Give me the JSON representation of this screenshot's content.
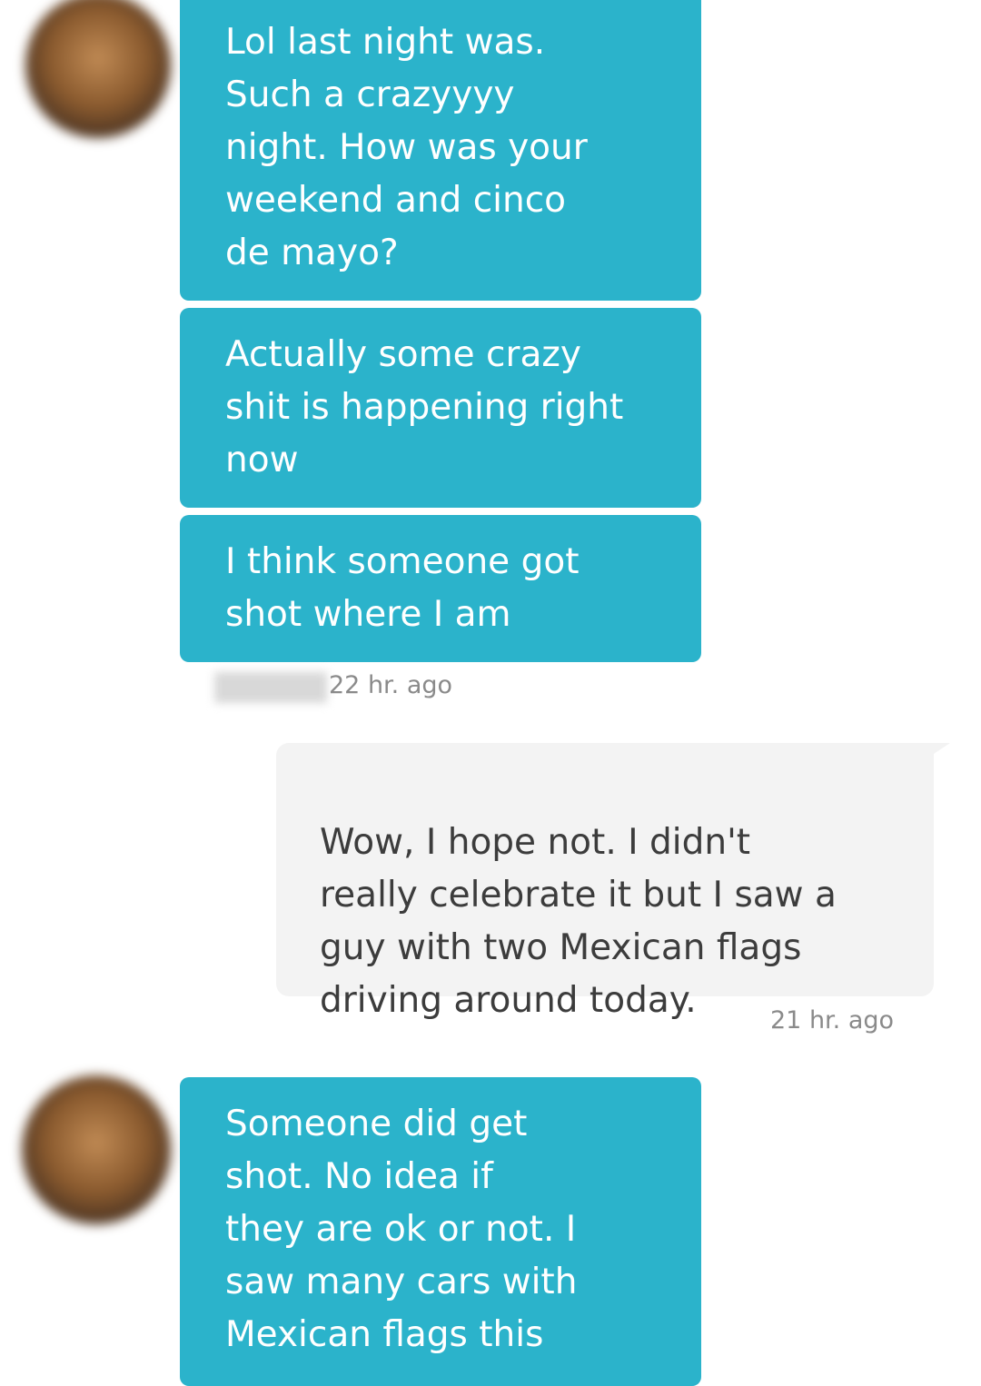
{
  "conversation": {
    "messages": [
      {
        "sender": "them",
        "text": "Lol last night was.\nSuch a crazyyyy\nnight. How was your\nweekend and cinco\nde mayo?"
      },
      {
        "sender": "them",
        "text": "Actually some crazy\nshit is happening right\nnow"
      },
      {
        "sender": "them",
        "text": "I think someone got\nshot where I am"
      },
      {
        "sender": "me",
        "text": "Wow, I hope not. I didn't\nreally celebrate it but I saw a\nguy with two Mexican flags\ndriving around today."
      },
      {
        "sender": "them",
        "text": "Someone did get\nshot. No idea if\nthey are ok or not. I\nsaw many cars with\nMexican flags this"
      }
    ],
    "timestamps": [
      "22 hr. ago",
      "21 hr. ago"
    ]
  },
  "colors": {
    "incoming_bubble": "#2bb3cb",
    "outgoing_bubble": "#f3f3f3",
    "incoming_text": "#ffffff",
    "outgoing_text": "#3c3c3c",
    "timestamp_text": "#8a8a8a"
  }
}
